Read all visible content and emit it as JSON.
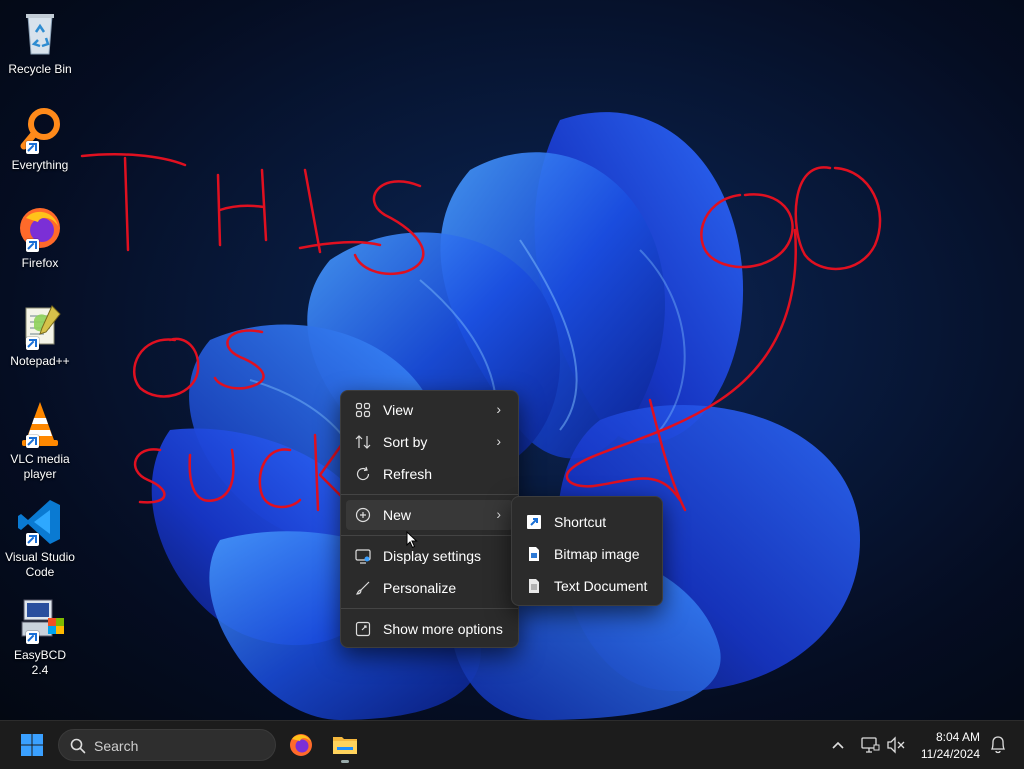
{
  "desktop": {
    "icons": [
      {
        "label": "Recycle Bin",
        "icon": "recycle-bin-icon"
      },
      {
        "label": "Everything",
        "icon": "everything-magnifier-icon"
      },
      {
        "label": "Firefox",
        "icon": "firefox-icon"
      },
      {
        "label": "Notepad++",
        "icon": "notepad-plus-plus-icon"
      },
      {
        "label": "VLC media player",
        "icon": "vlc-cone-icon"
      },
      {
        "label": "Visual Studio Code",
        "icon": "vscode-icon"
      },
      {
        "label": "EasyBCD 2.4",
        "icon": "easybcd-icon"
      }
    ],
    "scribble_color": "#e01020"
  },
  "context_menu": {
    "items": [
      {
        "label": "View",
        "icon": "grid-view-icon",
        "submenu": true
      },
      {
        "label": "Sort by",
        "icon": "sort-icon",
        "submenu": true
      },
      {
        "label": "Refresh",
        "icon": "refresh-icon",
        "submenu": false
      },
      {
        "label": "New",
        "icon": "plus-circle-icon",
        "submenu": true,
        "highlighted": true
      },
      {
        "label": "Display settings",
        "icon": "display-settings-icon",
        "submenu": false
      },
      {
        "label": "Personalize",
        "icon": "brush-icon",
        "submenu": false
      },
      {
        "label": "Show more options",
        "icon": "show-more-options-icon",
        "submenu": false
      }
    ]
  },
  "submenu_new": {
    "items": [
      {
        "label": "Shortcut",
        "icon": "shortcut-icon"
      },
      {
        "label": "Bitmap image",
        "icon": "bitmap-file-icon"
      },
      {
        "label": "Text Document",
        "icon": "text-document-icon"
      }
    ]
  },
  "taskbar": {
    "search_label": "Search",
    "time": "8:04 AM",
    "date": "11/24/2024",
    "accent": "#1e90ff"
  }
}
